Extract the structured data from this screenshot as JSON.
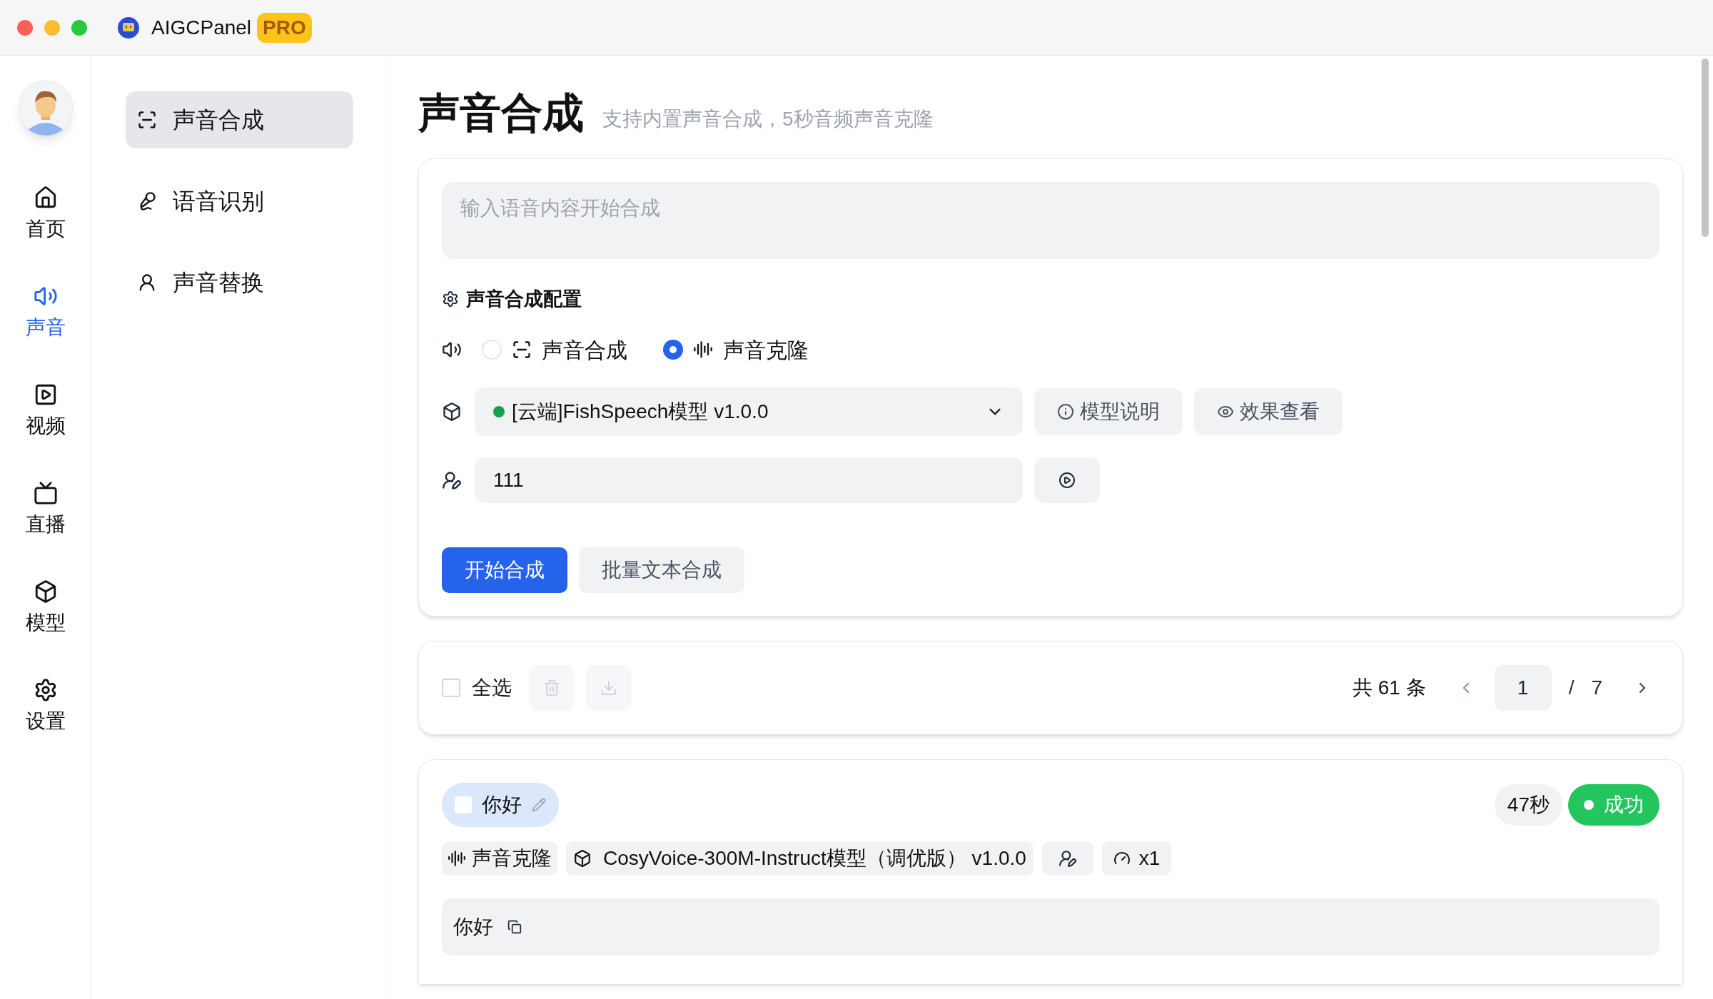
{
  "window": {
    "title": "AIGCPanel",
    "badge": "PRO"
  },
  "rail": {
    "items": [
      {
        "label": "首页",
        "selected": false
      },
      {
        "label": "声音",
        "selected": true
      },
      {
        "label": "视频",
        "selected": false
      },
      {
        "label": "直播",
        "selected": false
      },
      {
        "label": "模型",
        "selected": false
      },
      {
        "label": "设置",
        "selected": false
      }
    ]
  },
  "subnav": {
    "items": [
      {
        "label": "声音合成",
        "selected": true
      },
      {
        "label": "语音识别",
        "selected": false
      },
      {
        "label": "声音替换",
        "selected": false
      }
    ]
  },
  "page": {
    "title": "声音合成",
    "subtitle": "支持内置声音合成，5秒音频声音克隆"
  },
  "composer": {
    "placeholder": "输入语音内容开始合成",
    "config_title": "声音合成配置",
    "modes": [
      {
        "label": "声音合成",
        "selected": false
      },
      {
        "label": "声音克隆",
        "selected": true
      }
    ],
    "model": {
      "value": "[云端]FishSpeech模型 v1.0.0",
      "color": "#16a34a"
    },
    "model_buttons": [
      "模型说明",
      "效果查看"
    ],
    "voice": {
      "value": "111"
    },
    "buttons": [
      {
        "label": "开始合成",
        "kind": "primary"
      },
      {
        "label": "批量文本合成",
        "kind": "secondary"
      }
    ]
  },
  "toolbar": {
    "select_all": {
      "label": "全选",
      "checked": false
    },
    "total": "共 61 条",
    "page": "1",
    "separator": "/",
    "page_count": "7"
  },
  "records": [
    {
      "title": "你好",
      "checked": false,
      "duration": "47秒",
      "status": {
        "label": "成功",
        "kind": "success"
      },
      "mode": "声音克隆",
      "model": "CosyVoice-300M-Instruct模型（调优版） v1.0.0",
      "speed": "x1",
      "text": "你好"
    }
  ]
}
